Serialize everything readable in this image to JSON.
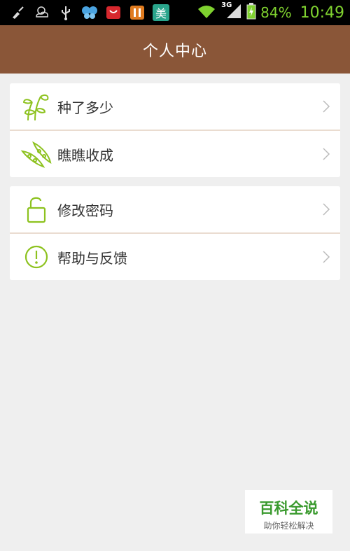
{
  "status_bar": {
    "network": "3G",
    "battery_percent": "84%",
    "time": "10:49",
    "notification_icons": [
      "broom-icon",
      "weather-icon",
      "usb-icon",
      "butterfly-icon",
      "shopping-bag-icon",
      "app-icon",
      "mei-app-icon"
    ],
    "mei_char": "美"
  },
  "header": {
    "title": "个人中心"
  },
  "menu": {
    "group1": [
      {
        "label": "种了多少",
        "icon": "sprout-icon"
      },
      {
        "label": "瞧瞧收成",
        "icon": "pea-pod-icon"
      }
    ],
    "group2": [
      {
        "label": "修改密码",
        "icon": "unlock-icon"
      },
      {
        "label": "帮助与反馈",
        "icon": "exclamation-circle-icon"
      }
    ]
  },
  "watermark": {
    "title": "百科全说",
    "subtitle": "助你轻松解决"
  },
  "colors": {
    "header": "#8a5638",
    "accent_green": "#8dc21f",
    "status_green": "#7fd12f"
  }
}
